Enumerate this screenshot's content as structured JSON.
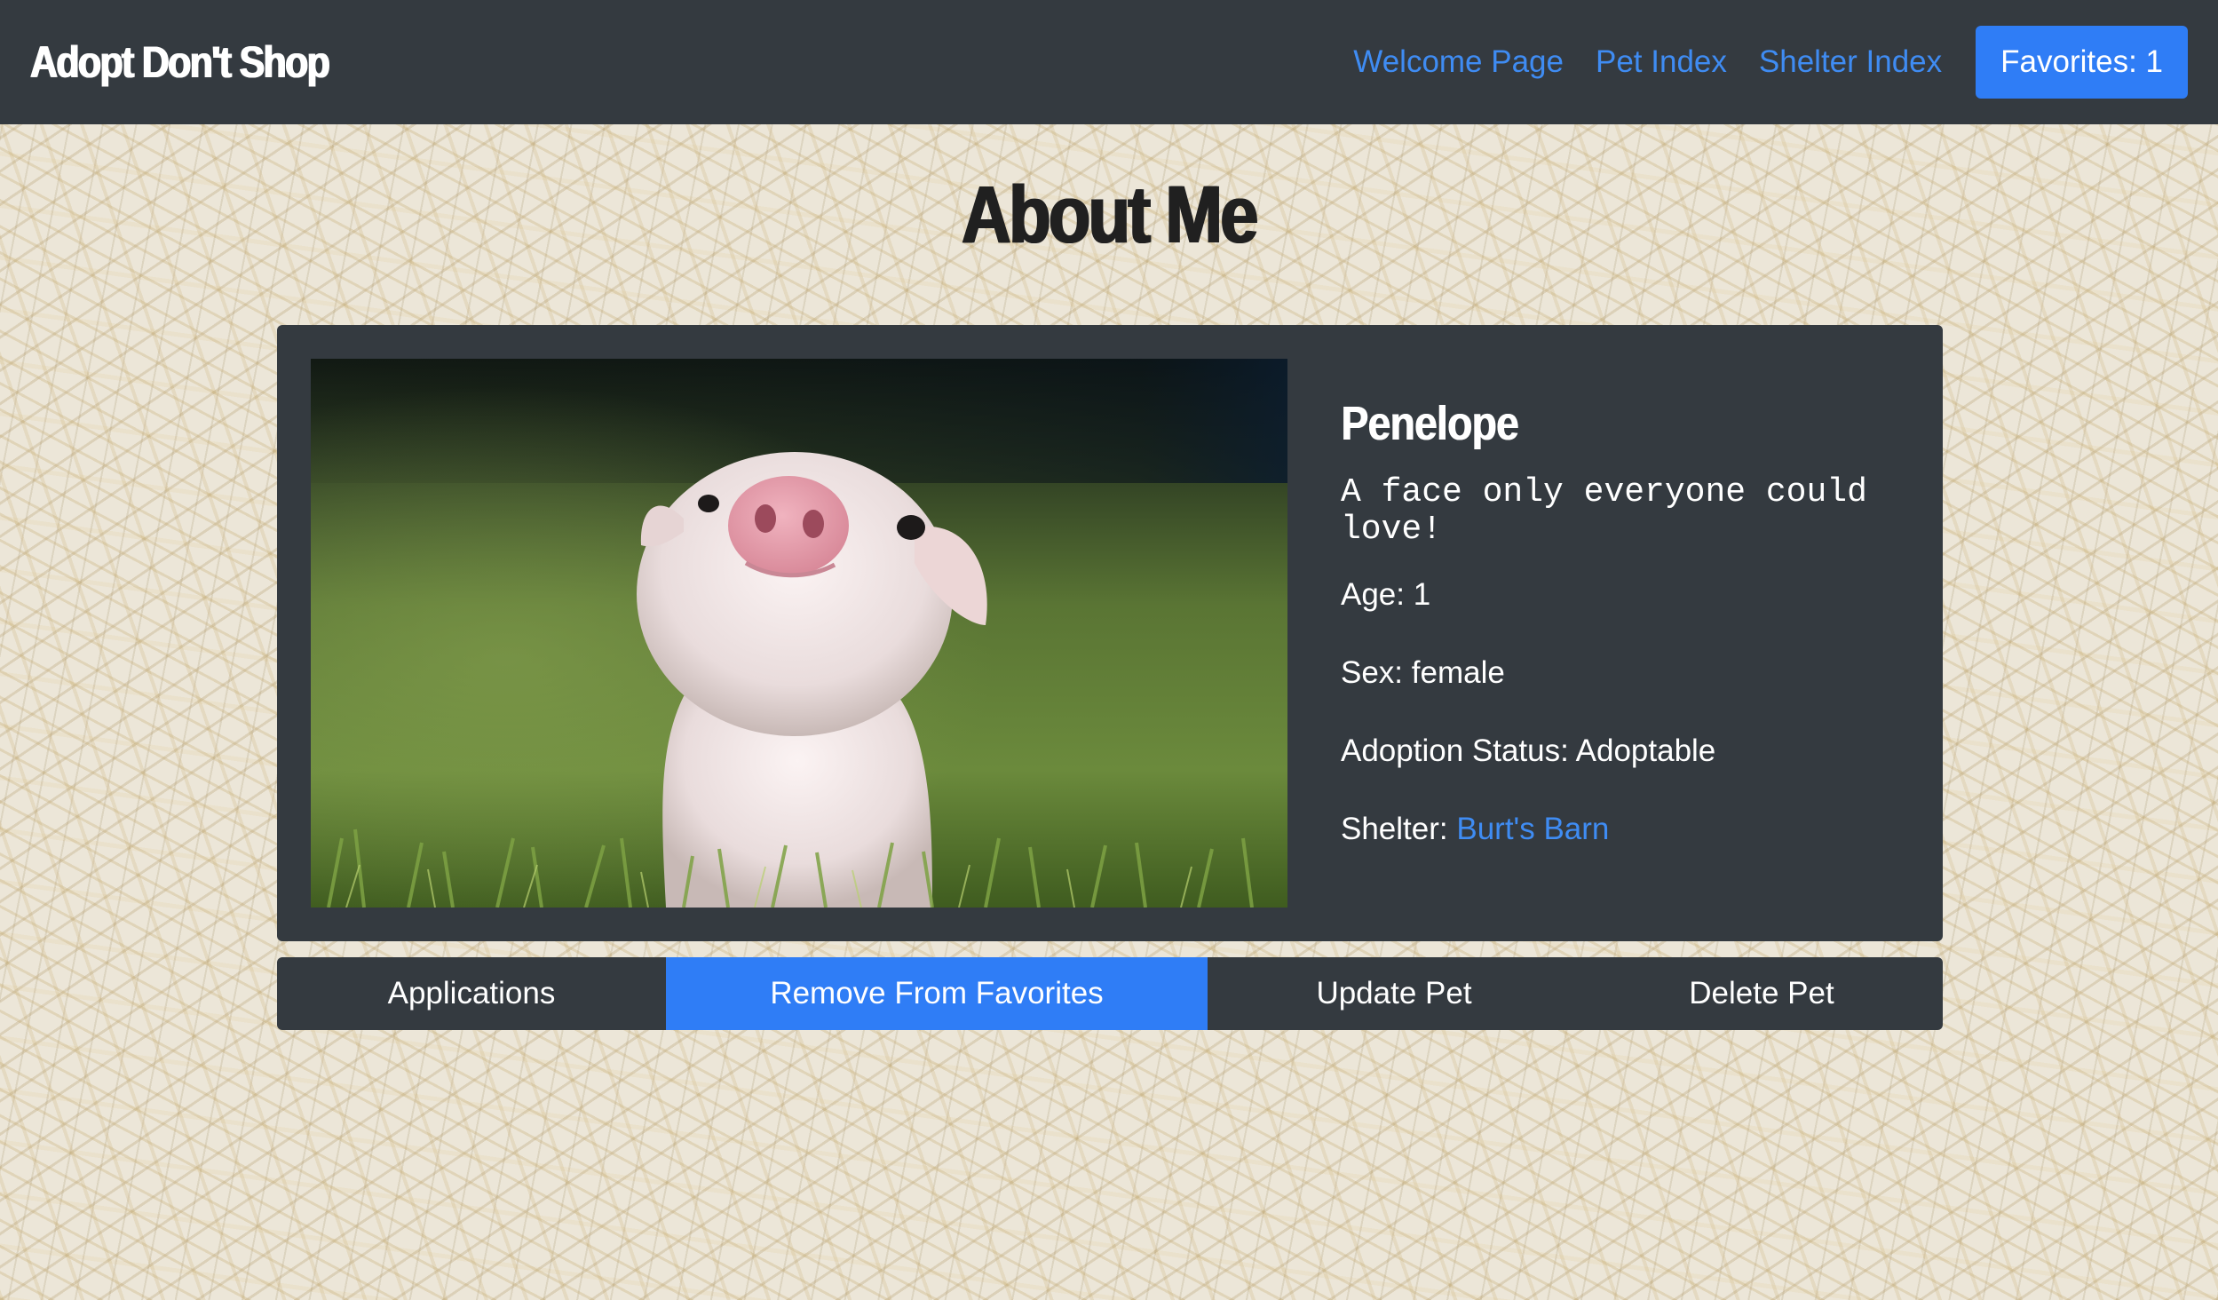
{
  "navbar": {
    "brand": "Adopt Don't Shop",
    "links": [
      "Welcome Page",
      "Pet Index",
      "Shelter Index"
    ],
    "favorites_label": "Favorites: 1"
  },
  "page": {
    "title": "About Me"
  },
  "pet": {
    "name": "Penelope",
    "description": "A face only everyone could love!",
    "age_label": "Age: 1",
    "sex_label": "Sex: female",
    "status_label": "Adoption Status: Adoptable",
    "shelter_prefix": "Shelter: ",
    "shelter_name": "Burt's Barn",
    "photo_subject": "piglet-in-grass"
  },
  "actions": {
    "applications": "Applications",
    "remove_favorite": "Remove From Favorites",
    "update": "Update Pet",
    "delete": "Delete Pet"
  },
  "colors": {
    "navbar_bg": "#343a40",
    "link": "#3f8cf3",
    "primary": "#2f7df6",
    "card_bg": "#343a40"
  }
}
